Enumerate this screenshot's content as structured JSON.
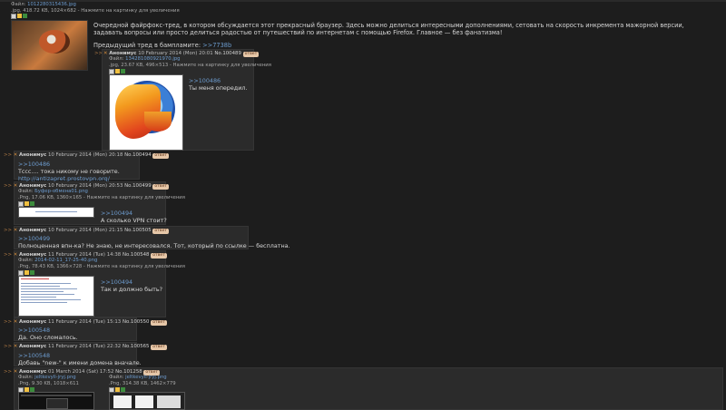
{
  "op": {
    "file_label": "Файл:",
    "file_name": "1012280315436.jpg",
    "file_meta": ".jpg, 418.72 KB, 1024×682 - Нажмите на картинку для увеличения",
    "paragraph1": "Очередной файрфокс-тред, в котором обсуждается этот прекрасный браузер. Здесь можно делиться интересными дополнениями, сетовать на скорость инкремента мажорной версии, задавать вопросы или просто делиться радостью от путешествий по интернетам с помощью Firefox. Главное — без фанатизма!",
    "prev_thread_label": "Предыдущий тред в бампламите:",
    "prev_thread_link": ">>7738b"
  },
  "reply_arrow": ">>",
  "close_mark": "✕",
  "author": "Аноним",
  "author_postfix": "ус",
  "reply_badge": "ответ",
  "file_label": "Файл:",
  "click_hint": "Нажмите на картинку для увеличения",
  "posts": [
    {
      "date": "10 February 2014 (Mon) 20:01",
      "no_label": "No.",
      "no": "100489",
      "file_name": "134281080921970.jpg",
      "file_meta": ".jpg, 23.67 KB, 496×513 - Нажмите на картинку для увеличения",
      "quote": ">>100486",
      "text": "Ты меня опередил."
    },
    {
      "date": "10 February 2014 (Mon) 20:18",
      "no_label": "No.",
      "no": "100494",
      "quote": ">>100486",
      "text": "Тссс.... тока никому не говорите.",
      "link": "http://antizapret.prostovpn.org/"
    },
    {
      "date": "10 February 2014 (Mon) 20:53",
      "no_label": "No.",
      "no": "100499",
      "file_name": "Буфер-обмена01.png",
      "file_meta": ".Png, 17.06 KB, 1360×165 - Нажмите на картинку для увеличения",
      "quote": ">>100494",
      "text": "А сколько VPN стоит?"
    },
    {
      "date": "10 February 2014 (Mon) 21:15",
      "no_label": "No.",
      "no": "100505",
      "quote": ">>100499",
      "text": "Полноценная впн-ка? Не знаю, не интересовался. Тот, который по ссылке — бесплатна."
    },
    {
      "date": "11 February 2014 (Tue) 14:38",
      "no_label": "No.",
      "no": "100548",
      "file_name": "2014-02-11_17-25-40.png",
      "file_meta": ".Png, 78.43 KB, 1366×728 - Нажмите на картинку для увеличения",
      "quote": ">>100494",
      "text": "Так и должно быть?"
    },
    {
      "date": "11 February 2014 (Tue) 15:13",
      "no_label": "No.",
      "no": "100550",
      "quote": ">>100548",
      "text": "Да. Оно сломалось."
    },
    {
      "date": "11 February 2014 (Tue) 22:32",
      "no_label": "No.",
      "no": "100565",
      "quote": ">>100548",
      "text": "Добавь \"new-\" к имени домена вначале."
    },
    {
      "date": "01 March 2014 (Sat) 17:52",
      "no_label": "No.",
      "no": "101258",
      "file_name": "jeltkevyli-jryj.png",
      "file_meta": ".Png, 9.30 KB, 1018×611",
      "file2_name": "jeltkevyli-jryj.png",
      "file2_meta": ".Png, 314.38 KB, 1462×779"
    }
  ]
}
